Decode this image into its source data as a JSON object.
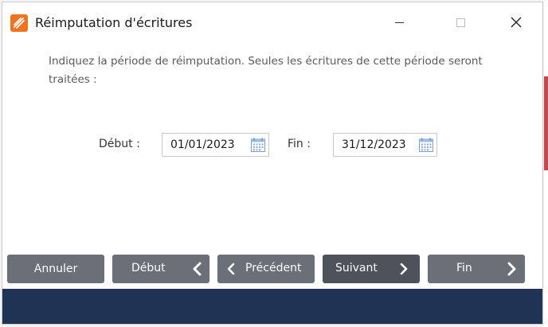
{
  "window": {
    "title": "Réimputation d'écritures"
  },
  "instruction": "Indiquez la période de réimputation. Seules les écritures de cette période seront traitées :",
  "fields": {
    "start_label": "Début :",
    "start_value": "01/01/2023",
    "end_label": "Fin :",
    "end_value": "31/12/2023"
  },
  "buttons": {
    "cancel": "Annuler",
    "first": "Début",
    "previous": "Précédent",
    "next": "Suivant",
    "last": "Fin"
  },
  "colors": {
    "brand": "#f0731f",
    "button": "#6a6f78",
    "button_dark": "#4d525b",
    "footer": "#1f3354"
  },
  "icons": [
    "app-logo-icon",
    "minimize-icon",
    "maximize-icon",
    "close-icon",
    "calendar-icon",
    "chevron-left-icon",
    "chevron-right-icon"
  ]
}
